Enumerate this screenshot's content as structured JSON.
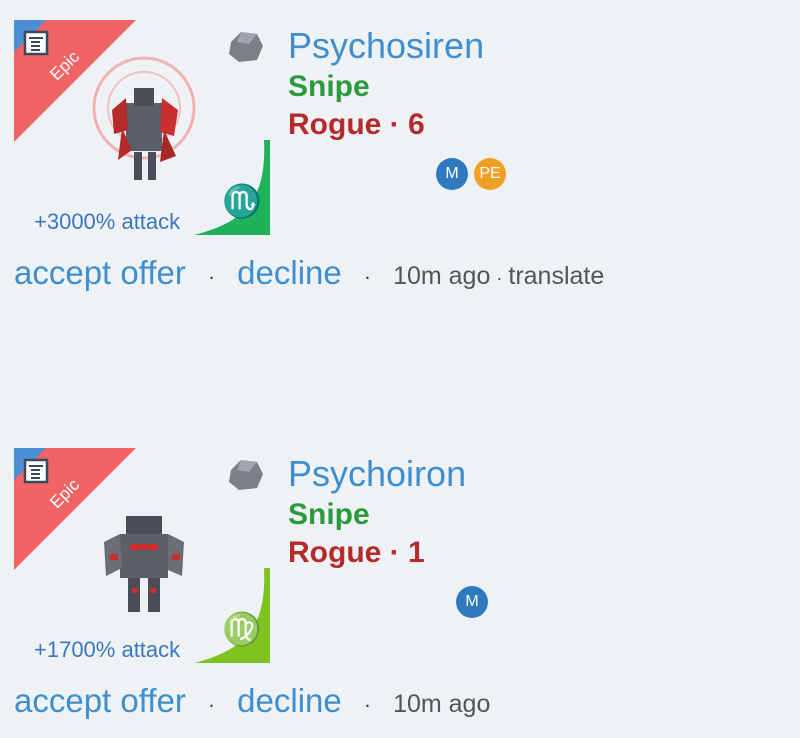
{
  "offers": [
    {
      "rarity": "Epic",
      "bonus": "+3000% attack",
      "zodiac_sign": "♏",
      "name": "Psychosiren",
      "type": "Snipe",
      "class": "Rogue",
      "level": "6",
      "badges": [
        "M",
        "PE"
      ],
      "accept_label": "accept offer",
      "decline_label": "decline",
      "time": "10m ago",
      "translate_label": "translate",
      "colors": {
        "rarity": "#f06466",
        "corner": "#1fb25a"
      }
    },
    {
      "rarity": "Epic",
      "bonus": "+1700% attack",
      "zodiac_sign": "♍",
      "name": "Psychoiron",
      "type": "Snipe",
      "class": "Rogue",
      "level": "1",
      "badges": [
        "M"
      ],
      "accept_label": "accept offer",
      "decline_label": "decline",
      "time": "10m ago",
      "colors": {
        "rarity": "#f06466",
        "corner": "#7ec322"
      }
    }
  ],
  "separator": "·",
  "icons": {
    "calendar": "calendar-icon",
    "ore": "ore-rock-icon"
  }
}
